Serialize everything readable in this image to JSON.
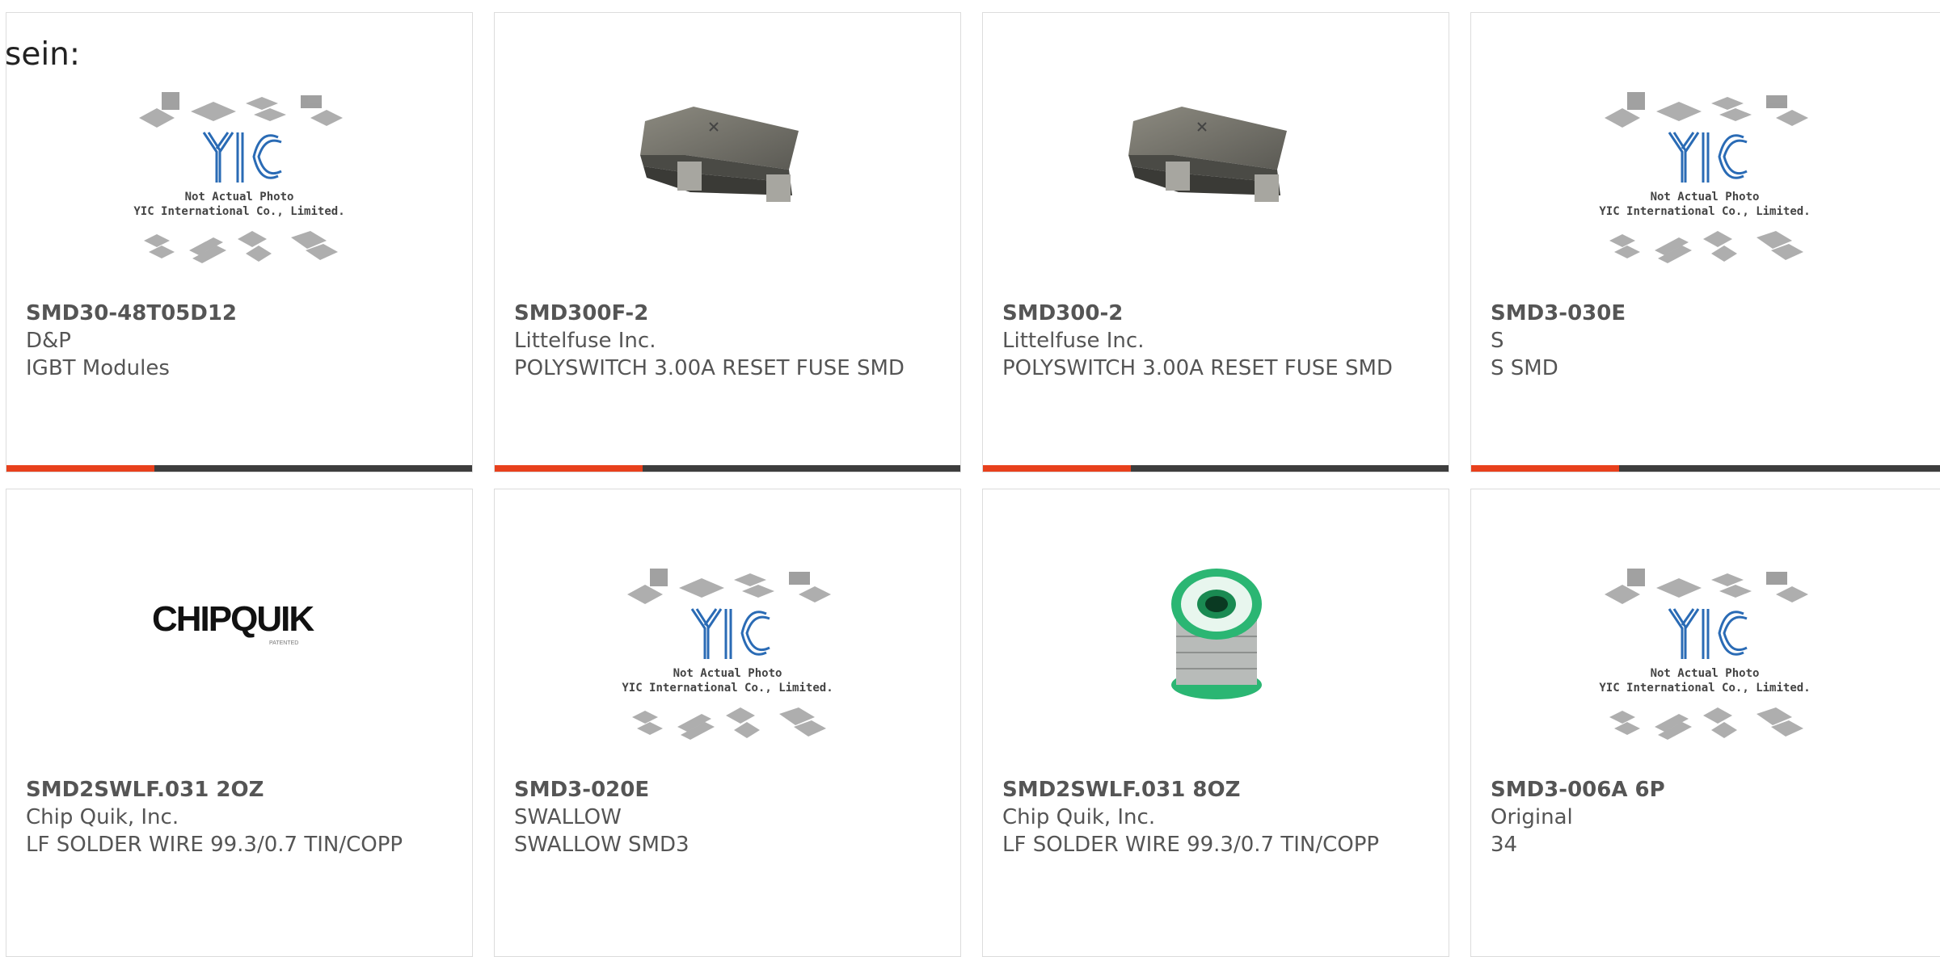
{
  "lead_text": "sein:",
  "colors": {
    "accent": "#e8401c",
    "bar": "#3d3d3d",
    "text": "#555555",
    "yic_blue": "#2a6bb5"
  },
  "placeholder": {
    "line1": "Not Actual Photo",
    "line2": "YIC International Co., Limited."
  },
  "products": [
    {
      "part": "SMD30-48T05D12",
      "manufacturer": "D&P",
      "description": "IGBT Modules",
      "image": "yic-placeholder-icon"
    },
    {
      "part": "SMD300F-2",
      "manufacturer": "Littelfuse Inc.",
      "description": "POLYSWITCH 3.00A RESET FUSE SMD",
      "image": "fuse-chip-icon"
    },
    {
      "part": "SMD300-2",
      "manufacturer": "Littelfuse Inc.",
      "description": "POLYSWITCH 3.00A RESET FUSE SMD",
      "image": "fuse-chip-icon"
    },
    {
      "part": "SMD3-030E",
      "manufacturer": "S",
      "description": "S SMD",
      "image": "yic-placeholder-icon"
    },
    {
      "part": "SMD2SWLF.031 2OZ",
      "manufacturer": "Chip Quik, Inc.",
      "description": "LF SOLDER WIRE 99.3/0.7 TIN/COPP",
      "image": "chipquik-logo",
      "logo_text": "CHIPQUIK",
      "logo_sub": "PATENTED"
    },
    {
      "part": "SMD3-020E",
      "manufacturer": "SWALLOW",
      "description": "SWALLOW SMD3",
      "image": "yic-placeholder-icon"
    },
    {
      "part": "SMD2SWLF.031 8OZ",
      "manufacturer": "Chip Quik, Inc.",
      "description": "LF SOLDER WIRE 99.3/0.7 TIN/COPP",
      "image": "solder-spool-icon"
    },
    {
      "part": "SMD3-006A 6P",
      "manufacturer": "Original",
      "description": "34",
      "image": "yic-placeholder-icon"
    }
  ]
}
